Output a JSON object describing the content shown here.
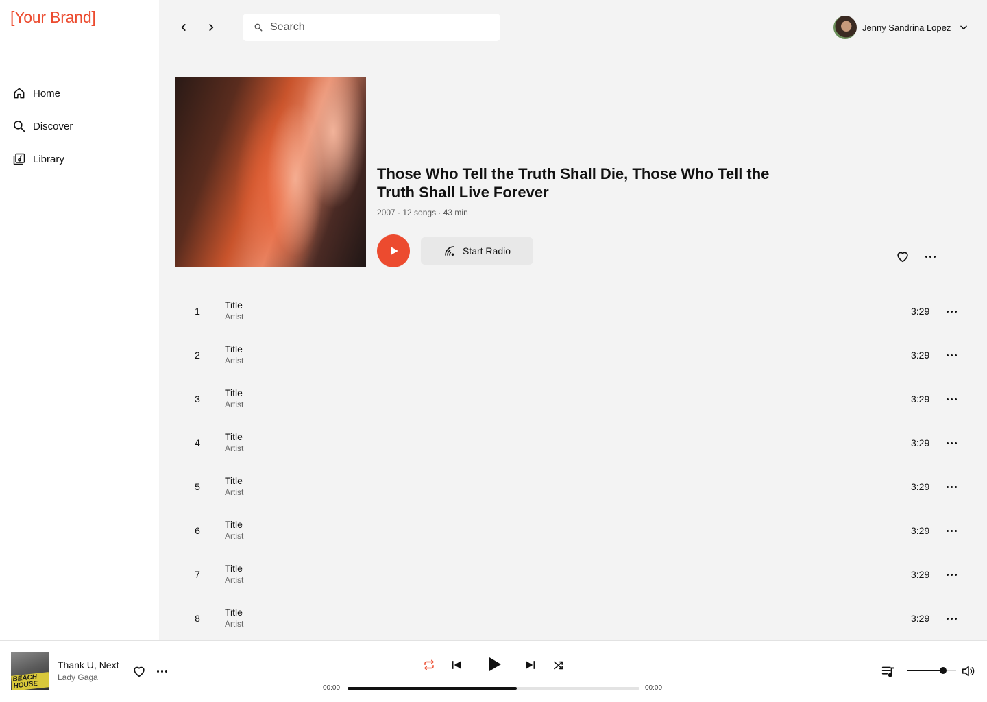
{
  "brand": "[Your Brand]",
  "sidebar": {
    "items": [
      {
        "label": "Home",
        "icon": "home-icon"
      },
      {
        "label": "Discover",
        "icon": "search-icon"
      },
      {
        "label": "Library",
        "icon": "library-icon"
      }
    ]
  },
  "search": {
    "placeholder": "Search",
    "value": ""
  },
  "user": {
    "name": "Jenny Sandrina Lopez"
  },
  "album": {
    "title": "Those Who Tell the Truth Shall Die, Those Who Tell the Truth Shall Live Forever",
    "meta": "2007 · 12 songs · 43 min",
    "radio_label": "Start Radio"
  },
  "tracks": [
    {
      "number": "1",
      "title": "Title",
      "artist": "Artist",
      "duration": "3:29"
    },
    {
      "number": "2",
      "title": "Title",
      "artist": "Artist",
      "duration": "3:29"
    },
    {
      "number": "3",
      "title": "Title",
      "artist": "Artist",
      "duration": "3:29"
    },
    {
      "number": "4",
      "title": "Title",
      "artist": "Artist",
      "duration": "3:29"
    },
    {
      "number": "5",
      "title": "Title",
      "artist": "Artist",
      "duration": "3:29"
    },
    {
      "number": "6",
      "title": "Title",
      "artist": "Artist",
      "duration": "3:29"
    },
    {
      "number": "7",
      "title": "Title",
      "artist": "Artist",
      "duration": "3:29"
    },
    {
      "number": "8",
      "title": "Title",
      "artist": "Artist",
      "duration": "3:29"
    }
  ],
  "player": {
    "title": "Thank U, Next",
    "artist": "Lady Gaga",
    "art_text": "BEACH HOUSE",
    "elapsed": "00:00",
    "total": "00:00",
    "progress": 0.58,
    "volume": 0.72
  },
  "colors": {
    "accent": "#ec4b2f"
  }
}
